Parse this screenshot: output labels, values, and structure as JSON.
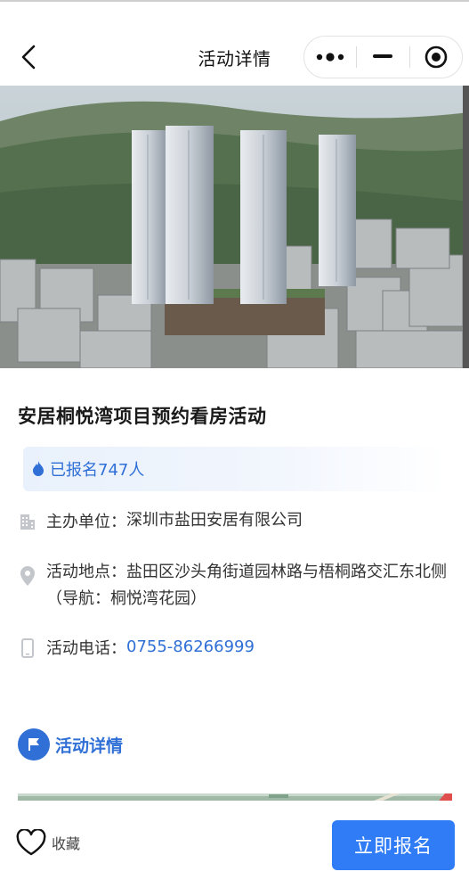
{
  "nav": {
    "title": "活动详情",
    "back_icon": "chevron-left-icon",
    "capsule_icons": [
      "more-dots-icon",
      "minimize-icon",
      "target-icon"
    ]
  },
  "hero": {
    "image": "residential-towers-aerial-rendering"
  },
  "activity": {
    "title": "安居桐悦湾项目预约看房活动",
    "enrolled_text": "已报名747人",
    "organizer_label": "主办单位：",
    "organizer_value": "深圳市盐田安居有限公司",
    "location_label": "活动地点：",
    "location_value": "盐田区沙头角街道园林路与梧桐路交汇东北侧（导航：桐悦湾花园）",
    "phone_label": "活动电话：",
    "phone_value": "0755-86266999"
  },
  "section": {
    "details_title": "活动详情"
  },
  "bottom": {
    "favorite_label": "收藏",
    "signup_label": "立即报名"
  },
  "colors": {
    "accent": "#2f7cf6",
    "link": "#2f6fd6",
    "enroll_bg": "#e9f1fc"
  }
}
